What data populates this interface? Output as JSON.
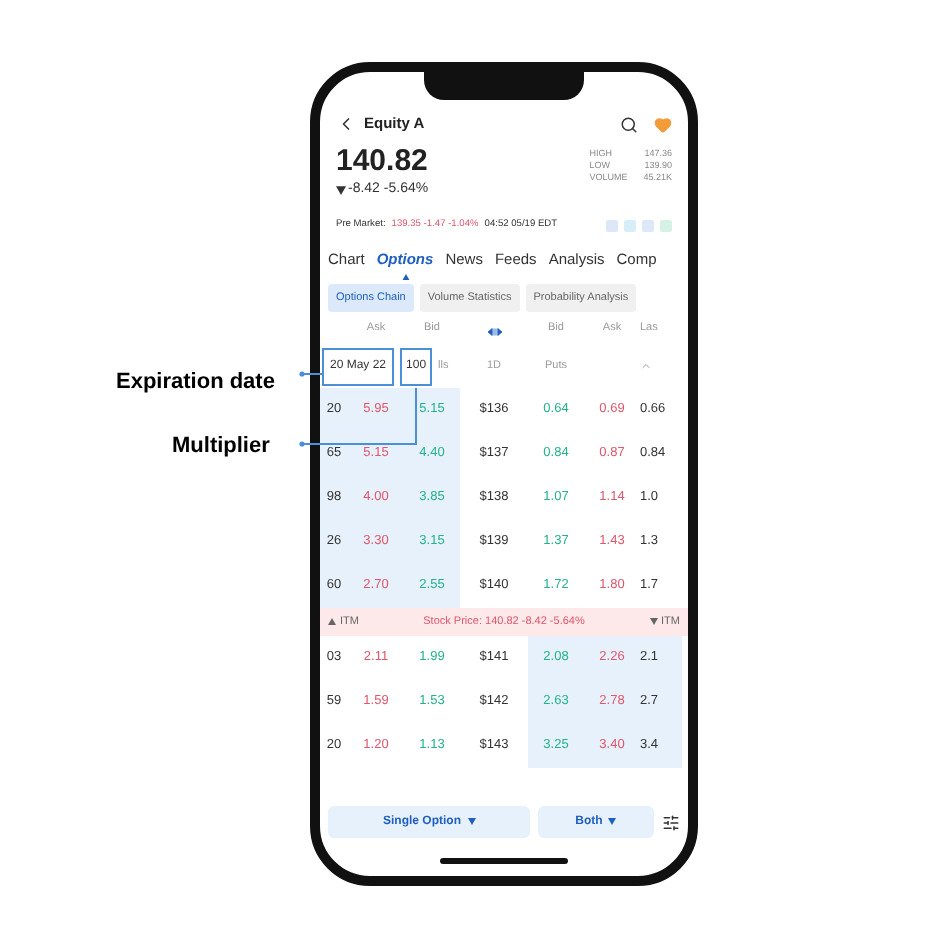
{
  "annotations": [
    {
      "label": "Expiration date"
    },
    {
      "label": "Multiplier"
    }
  ],
  "header": {
    "title": "Equity A",
    "favorite": true
  },
  "quote": {
    "price": "140.82",
    "change": "-8.42 -5.64%",
    "falling": true,
    "stats": [
      {
        "label": "HIGH",
        "value": "147.36"
      },
      {
        "label": "LOW",
        "value": "139.90"
      },
      {
        "label": "VOLUME",
        "value": "45.21K"
      }
    ]
  },
  "pre_market": {
    "label": "Pre Market:",
    "change": "139.35 -1.47 -1.04%",
    "time": "04:52 05/19 EDT"
  },
  "tabs": [
    {
      "label": "Chart",
      "selected": false
    },
    {
      "label": "Options",
      "selected": true
    },
    {
      "label": "News",
      "selected": false
    },
    {
      "label": "Feeds",
      "selected": false
    },
    {
      "label": "Analysis",
      "selected": false
    },
    {
      "label": "Comp",
      "selected": false
    }
  ],
  "sub_tabs": [
    {
      "label": "Options Chain",
      "selected": true
    },
    {
      "label": "Volume Statistics",
      "selected": false
    },
    {
      "label": "Probability Analysis",
      "selected": false
    }
  ],
  "chain_header": {
    "calls_ask": "Ask",
    "calls_bid": "Bid",
    "expiration": "20 May 22",
    "multiplier": "100",
    "calls": "lls",
    "period": "1D",
    "puts_bid": "Bid",
    "puts_ask": "Ask",
    "puts_last": "Las",
    "puts": "Puts"
  },
  "rows": [
    {
      "kind": "strike",
      "last": "20",
      "ask": "5.95",
      "bid": "5.15",
      "strike": "$136",
      "put_bid": "0.64",
      "put_ask": "0.69",
      "put_last": "0.66",
      "calls_itm": true,
      "puts_itm": false
    },
    {
      "kind": "strike",
      "last": "65",
      "ask": "5.15",
      "bid": "4.40",
      "strike": "$137",
      "put_bid": "0.84",
      "put_ask": "0.87",
      "put_last": "0.84",
      "calls_itm": true,
      "puts_itm": false
    },
    {
      "kind": "strike",
      "last": "98",
      "ask": "4.00",
      "bid": "3.85",
      "strike": "$138",
      "put_bid": "1.07",
      "put_ask": "1.14",
      "put_last": "1.0",
      "calls_itm": true,
      "puts_itm": false
    },
    {
      "kind": "strike",
      "last": "26",
      "ask": "3.30",
      "bid": "3.15",
      "strike": "$139",
      "put_bid": "1.37",
      "put_ask": "1.43",
      "put_last": "1.3",
      "calls_itm": true,
      "puts_itm": false
    },
    {
      "kind": "strike",
      "last": "60",
      "ask": "2.70",
      "bid": "2.55",
      "strike": "$140",
      "put_bid": "1.72",
      "put_ask": "1.80",
      "put_last": "1.7",
      "calls_itm": true,
      "puts_itm": false
    },
    {
      "kind": "price",
      "left": "ITM",
      "text": "Stock Price: 140.82 -8.42 -5.64%",
      "right": "ITM"
    },
    {
      "kind": "strike",
      "last": "03",
      "ask": "2.11",
      "bid": "1.99",
      "strike": "$141",
      "put_bid": "2.08",
      "put_ask": "2.26",
      "put_last": "2.1",
      "calls_itm": false,
      "puts_itm": true
    },
    {
      "kind": "strike",
      "last": "59",
      "ask": "1.59",
      "bid": "1.53",
      "strike": "$142",
      "put_bid": "2.63",
      "put_ask": "2.78",
      "put_last": "2.7",
      "calls_itm": false,
      "puts_itm": true
    },
    {
      "kind": "strike",
      "last": "20",
      "ask": "1.20",
      "bid": "1.13",
      "strike": "$143",
      "put_bid": "3.25",
      "put_ask": "3.40",
      "put_last": "3.4",
      "calls_itm": false,
      "puts_itm": true
    }
  ],
  "bottom_bar": {
    "strategy": "Single Option",
    "side": "Both"
  }
}
